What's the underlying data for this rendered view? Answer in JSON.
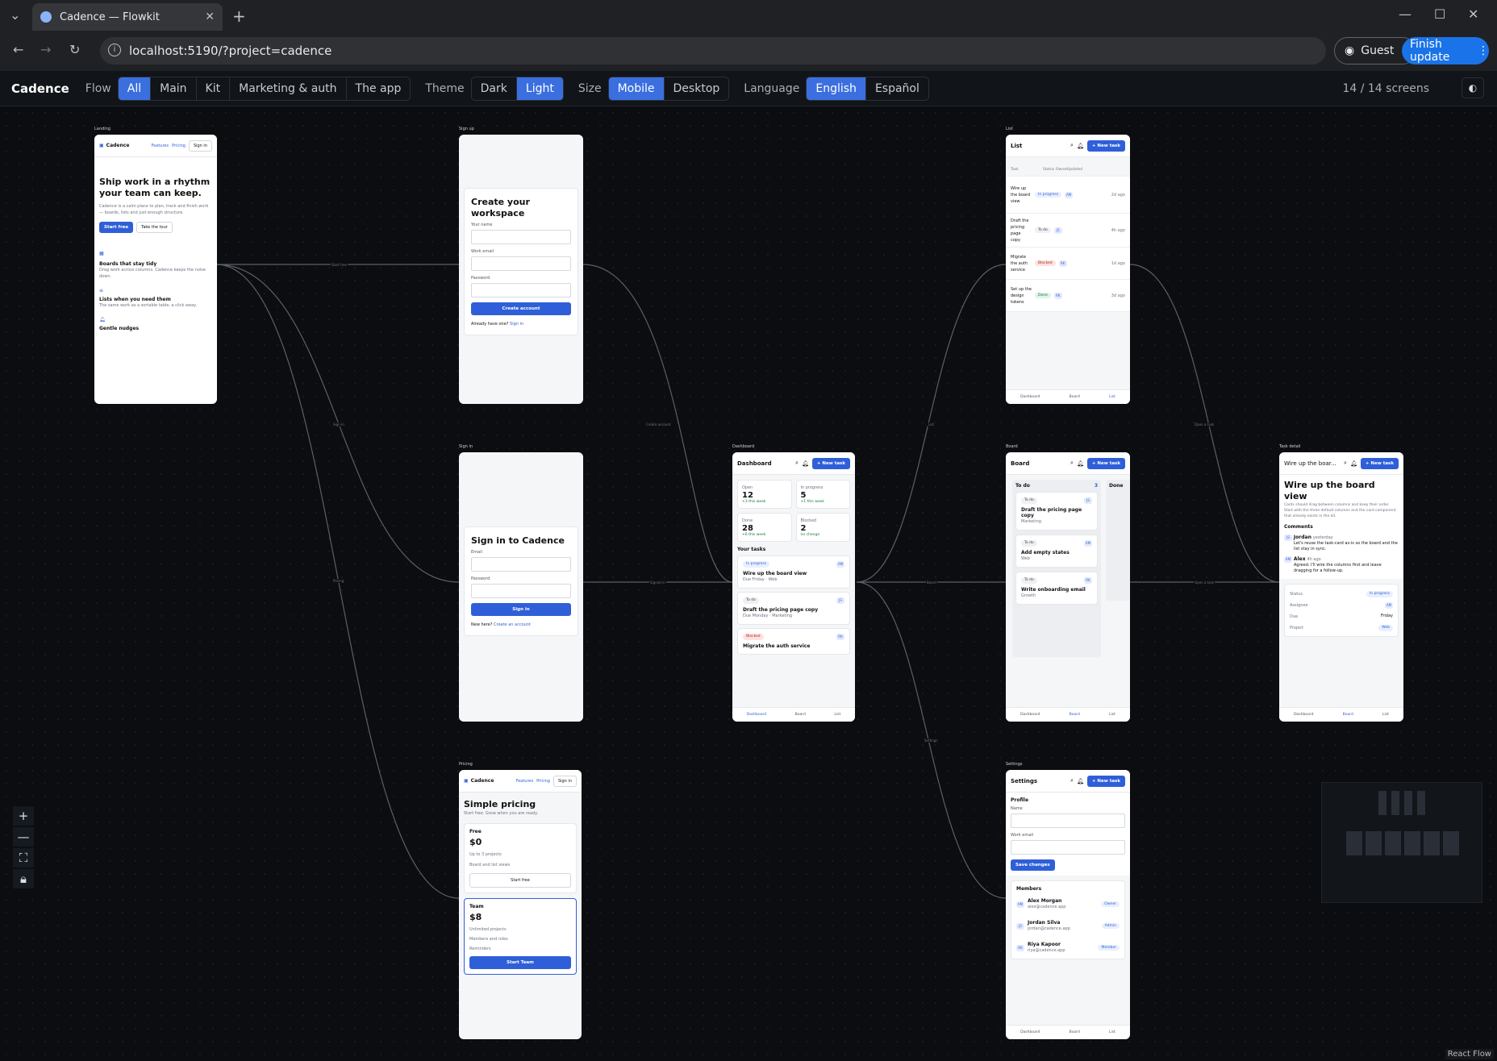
{
  "browser": {
    "tab_title": "Cadence — Flowkit",
    "url": "localhost:5190/?project=cadence",
    "guest_label": "Guest",
    "finish_label": "Finish update"
  },
  "toolbar": {
    "brand": "Cadence",
    "flow_label": "Flow",
    "flow_options": [
      "All",
      "Main",
      "Kit",
      "Marketing & auth",
      "The app"
    ],
    "theme_label": "Theme",
    "theme_options": [
      "Dark",
      "Light"
    ],
    "size_label": "Size",
    "size_options": [
      "Mobile",
      "Desktop"
    ],
    "language_label": "Language",
    "language_options": [
      "English",
      "Español"
    ],
    "screen_count": "14 / 14 screens",
    "accent_color": "#3b6fe0"
  },
  "edges": [
    "Start free",
    "Sign in",
    "Pricing",
    "Create account",
    "Signed in",
    "List",
    "Board",
    "Settings",
    "Open a task",
    "Open a task"
  ],
  "screens": {
    "landing": {
      "label": "Landing",
      "brand": "Cadence",
      "nav_features": "Features",
      "nav_pricing": "Pricing",
      "nav_signin": "Sign in",
      "headline": "Ship work in a rhythm your team can keep.",
      "sub": "Cadence is a calm place to plan, track and finish work — boards, lists and just enough structure.",
      "cta_primary": "Start free",
      "cta_secondary": "Take the tour",
      "f1_title": "Boards that stay tidy",
      "f1_text": "Drag work across columns. Cadence keeps the noise down.",
      "f2_title": "Lists when you need them",
      "f2_text": "The same work as a sortable table, a click away.",
      "f3_title": "Gentle nudges"
    },
    "signup": {
      "label": "Sign up",
      "title": "Create your workspace",
      "name_label": "Your name",
      "email_label": "Work email",
      "password_label": "Password",
      "submit": "Create account",
      "footer_text": "Already have one?",
      "footer_link": "Sign in"
    },
    "signin": {
      "label": "Sign in",
      "title": "Sign in to Cadence",
      "email_label": "Email",
      "password_label": "Password",
      "submit": "Sign in",
      "footer_text": "New here?",
      "footer_link": "Create an account"
    },
    "pricing": {
      "label": "Pricing",
      "brand": "Cadence",
      "nav_features": "Features",
      "nav_pricing": "Pricing",
      "nav_signin": "Sign in",
      "title": "Simple pricing",
      "sub": "Start free. Grow when you are ready.",
      "free_name": "Free",
      "free_price": "$0",
      "free_f1": "Up to 3 projects",
      "free_f2": "Board and list views",
      "free_cta": "Start free",
      "team_name": "Team",
      "team_price": "$8",
      "team_f1": "Unlimited projects",
      "team_f2": "Members and roles",
      "team_f3": "Reminders",
      "team_cta": "Start Team"
    },
    "dashboard": {
      "label": "Dashboard",
      "title": "Dashboard",
      "new_task": "New task",
      "stats": [
        {
          "label": "Open",
          "value": "12",
          "delta": "+3 this week"
        },
        {
          "label": "In progress",
          "value": "5",
          "delta": "+1 this week"
        },
        {
          "label": "Done",
          "value": "28",
          "delta": "+6 this week"
        },
        {
          "label": "Blocked",
          "value": "2",
          "delta": "no change"
        }
      ],
      "your_tasks": "Your tasks",
      "tasks": [
        {
          "status": "In progress",
          "owner": "AM",
          "title": "Wire up the board view",
          "meta": "Due Friday · Web"
        },
        {
          "status": "To do",
          "owner": "JS",
          "title": "Draft the pricing page copy",
          "meta": "Due Monday · Marketing"
        },
        {
          "status": "Blocked",
          "owner": "RK",
          "title": "Migrate the auth service",
          "meta": ""
        }
      ]
    },
    "list": {
      "label": "List",
      "title": "List",
      "new_task": "New task",
      "cols": [
        "Task",
        "Status",
        "Owner",
        "Updated"
      ],
      "rows": [
        {
          "task": "Wire up the board view",
          "status": "In progress",
          "owner": "AM",
          "updated": "2d ago"
        },
        {
          "task": "Draft the pricing page copy",
          "status": "To do",
          "owner": "JS",
          "updated": "4h ago"
        },
        {
          "task": "Migrate the auth service",
          "status": "Blocked",
          "owner": "RK",
          "updated": "1d ago"
        },
        {
          "task": "Set up the design tokens",
          "status": "Done",
          "owner": "RK",
          "updated": "3d ago"
        }
      ]
    },
    "board": {
      "label": "Board",
      "title": "Board",
      "new_task": "New task",
      "col_todo": "To do",
      "col_todo_count": "3",
      "col_done": "Done",
      "cards": [
        {
          "status": "To do",
          "owner": "JS",
          "title": "Draft the pricing page copy",
          "tag": "Marketing"
        },
        {
          "status": "To do",
          "owner": "AM",
          "title": "Add empty states",
          "tag": "Web"
        },
        {
          "status": "To do",
          "owner": "RK",
          "title": "Write onboarding email",
          "tag": "Growth"
        }
      ]
    },
    "detail": {
      "label": "Task detail",
      "title": "Wire up the boar...",
      "new_task": "New task",
      "heading": "Wire up the board view",
      "desc": "Cards should drag between columns and keep their order. Start with the three default columns and the card component that already exists in the kit.",
      "comments": "Comments",
      "c1_author": "Jordan",
      "c1_time": "yesterday",
      "c1_text": "Let's reuse the task-card as-is so the board and the list stay in sync.",
      "c2_author": "Alex",
      "c2_time": "4h ago",
      "c2_text": "Agreed. I'll wire the columns first and leave dragging for a follow-up.",
      "f_status": "Status",
      "v_status": "In progress",
      "f_assignee": "Assignee",
      "v_assignee": "AM",
      "f_due": "Due",
      "v_due": "Friday",
      "f_project": "Project",
      "v_project": "Web"
    },
    "settings": {
      "label": "Settings",
      "title": "Settings",
      "new_task": "New task",
      "profile": "Profile",
      "name_label": "Name",
      "email_label": "Work email",
      "save": "Save changes",
      "members": "Members",
      "people": [
        {
          "initials": "AM",
          "name": "Alex Morgan",
          "email": "alex@cadence.app",
          "role": "Owner"
        },
        {
          "initials": "JS",
          "name": "Jordan Silva",
          "email": "jordan@cadence.app",
          "role": "Admin"
        },
        {
          "initials": "RK",
          "name": "Riya Kapoor",
          "email": "riya@cadence.app",
          "role": "Member"
        }
      ]
    },
    "nav": {
      "dashboard": "Dashboard",
      "board": "Board",
      "list": "List"
    }
  },
  "react_flow": "React Flow"
}
